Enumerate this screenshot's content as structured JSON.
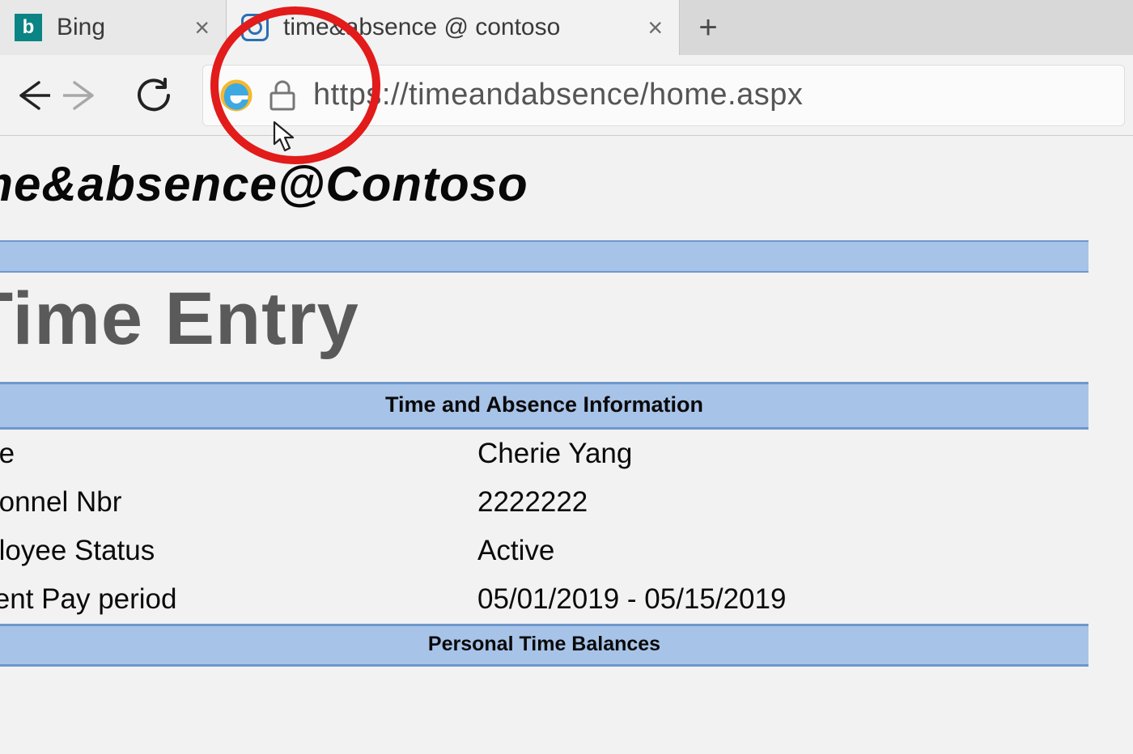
{
  "browser": {
    "tabs": [
      {
        "title": "Bing",
        "active": false
      },
      {
        "title": "time&absence @ contoso",
        "active": true
      }
    ],
    "url": "https://timeandabsence/home.aspx"
  },
  "page": {
    "site_title": "ime&absence@Contoso",
    "section_title": "Time Entry",
    "info_header": "Time and Absence Information",
    "balances_header": "Personal Time Balances",
    "fields": {
      "name_label": "ame",
      "name_value": "Cherie Yang",
      "personnel_label": "ersonnel Nbr",
      "personnel_value": "2222222",
      "status_label": "mployee Status",
      "status_value": "Active",
      "payperiod_label": "urrent Pay period",
      "payperiod_value": "05/01/2019 - 05/15/2019"
    }
  }
}
